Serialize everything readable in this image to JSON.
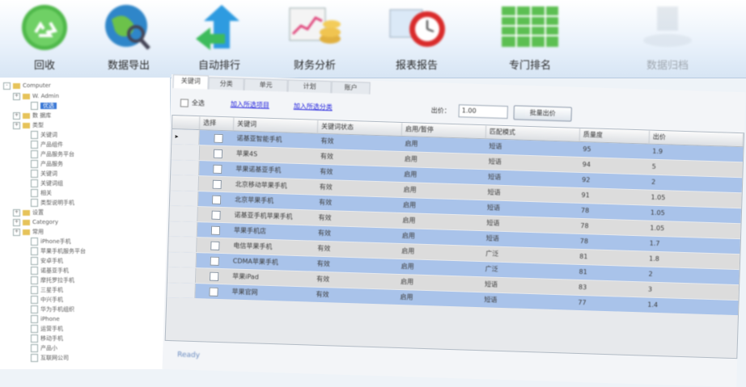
{
  "toolbar": {
    "items": [
      {
        "label": "回收",
        "icon": "recycle-icon"
      },
      {
        "label": "数据导出",
        "icon": "globe-search-icon"
      },
      {
        "label": "自动排行",
        "icon": "sync-arrows-icon"
      },
      {
        "label": "财务分析",
        "icon": "chart-coins-icon"
      },
      {
        "label": "报表报告",
        "icon": "clock-report-icon"
      },
      {
        "label": "专门排名",
        "icon": "table-grid-icon"
      },
      {
        "label": "数据归档",
        "icon": "archive-icon"
      }
    ]
  },
  "tree": {
    "root": "Computer",
    "items": [
      {
        "label": "W. Admin",
        "level": 1,
        "type": "folder"
      },
      {
        "label": "优选",
        "level": 2,
        "type": "doc",
        "selected": true
      },
      {
        "label": "数 据库",
        "level": 1,
        "type": "folder"
      },
      {
        "label": "类型",
        "level": 1,
        "type": "folder"
      },
      {
        "label": "关键词",
        "level": 2,
        "type": "doc"
      },
      {
        "label": "产品组件",
        "level": 2,
        "type": "doc"
      },
      {
        "label": "产品服务平台",
        "level": 2,
        "type": "doc"
      },
      {
        "label": "产品服务",
        "level": 2,
        "type": "doc"
      },
      {
        "label": "关键词",
        "level": 2,
        "type": "doc"
      },
      {
        "label": "关键词组",
        "level": 2,
        "type": "doc"
      },
      {
        "label": "相关",
        "level": 2,
        "type": "doc"
      },
      {
        "label": "类型说明手机",
        "level": 2,
        "type": "doc"
      },
      {
        "label": "设置",
        "level": 1,
        "type": "folder"
      },
      {
        "label": "Category",
        "level": 1,
        "type": "folder"
      },
      {
        "label": "常用",
        "level": 1,
        "type": "folder"
      },
      {
        "label": "iPhone手机",
        "level": 2,
        "type": "doc"
      },
      {
        "label": "苹果手机服务平台",
        "level": 2,
        "type": "doc"
      },
      {
        "label": "安卓手机",
        "level": 2,
        "type": "doc"
      },
      {
        "label": "诺基亚手机",
        "level": 2,
        "type": "doc"
      },
      {
        "label": "摩托罗拉手机",
        "level": 2,
        "type": "doc"
      },
      {
        "label": "三星手机",
        "level": 2,
        "type": "doc"
      },
      {
        "label": "中兴手机",
        "level": 2,
        "type": "doc"
      },
      {
        "label": "华为手机组织",
        "level": 2,
        "type": "doc"
      },
      {
        "label": "iPhone",
        "level": 2,
        "type": "doc"
      },
      {
        "label": "运营手机",
        "level": 2,
        "type": "doc"
      },
      {
        "label": "移动手机",
        "level": 2,
        "type": "doc"
      },
      {
        "label": "产品小",
        "level": 2,
        "type": "doc"
      },
      {
        "label": "互联网公司",
        "level": 2,
        "type": "doc"
      }
    ]
  },
  "tabs": [
    "关键词",
    "分类",
    "单元",
    "计划",
    "账户"
  ],
  "options": {
    "checkbox_label": "全选",
    "link1": "加入所选项目",
    "link2": "加入所选分类",
    "price_label": "出价：",
    "price_value": "1.00",
    "apply_button": "批量出价"
  },
  "table": {
    "columns": [
      "选择",
      "关键词",
      "关键词状态",
      "启用/暂停",
      "匹配模式",
      "质量度",
      "出价"
    ],
    "rows": [
      [
        "",
        "诺基亚智能手机",
        "有效",
        "启用",
        "短语",
        "95",
        "1.9"
      ],
      [
        "",
        "苹果4S",
        "有效",
        "启用",
        "短语",
        "94",
        "5"
      ],
      [
        "",
        "苹果诺基亚手机",
        "有效",
        "启用",
        "短语",
        "92",
        "2"
      ],
      [
        "",
        "北京移动苹果手机",
        "有效",
        "启用",
        "短语",
        "91",
        "1.05"
      ],
      [
        "",
        "北京苹果手机",
        "有效",
        "启用",
        "短语",
        "78",
        "1.05"
      ],
      [
        "",
        "诺基亚手机苹果手机",
        "有效",
        "启用",
        "短语",
        "78",
        "1.05"
      ],
      [
        "",
        "苹果手机店",
        "有效",
        "启用",
        "短语",
        "78",
        "1.7"
      ],
      [
        "",
        "电信苹果手机",
        "有效",
        "启用",
        "广泛",
        "81",
        "1.8"
      ],
      [
        "",
        "CDMA苹果手机",
        "有效",
        "启用",
        "广泛",
        "81",
        "2"
      ],
      [
        "",
        "苹果iPad",
        "有效",
        "启用",
        "短语",
        "83",
        "3"
      ],
      [
        "",
        "苹果官网",
        "有效",
        "启用",
        "短语",
        "77",
        "1.4"
      ]
    ]
  },
  "status": "Ready"
}
